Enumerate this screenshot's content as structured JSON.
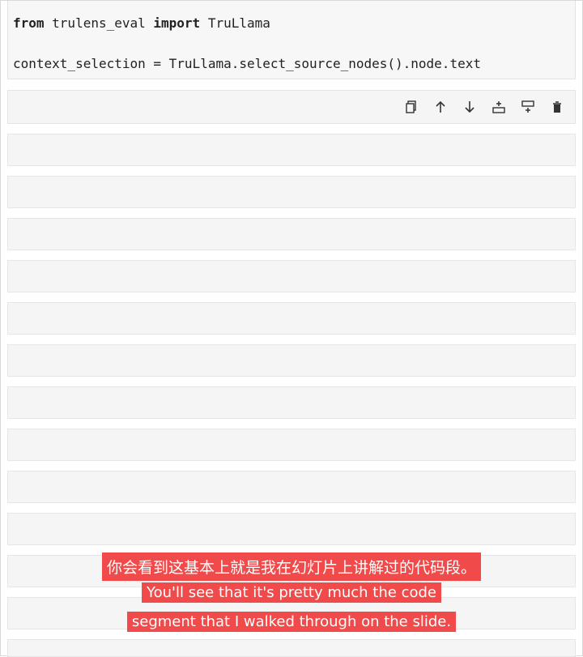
{
  "code": {
    "line1": {
      "keyword1": "from",
      "module": " trulens_eval ",
      "keyword2": "import",
      "name": " TruLlama"
    },
    "line2": "context_selection = TruLlama.select_source_nodes().node.text"
  },
  "toolbar": {
    "icons": [
      "copy-icon",
      "arrow-up-icon",
      "arrow-down-icon",
      "insert-above-icon",
      "insert-below-icon",
      "delete-icon"
    ]
  },
  "subtitles": {
    "chinese": "你会看到这基本上就是我在幻灯片上讲解过的代码段。",
    "english_line1": "You'll see that it's pretty much the code",
    "english_line2": "segment that I walked through on the slide."
  }
}
